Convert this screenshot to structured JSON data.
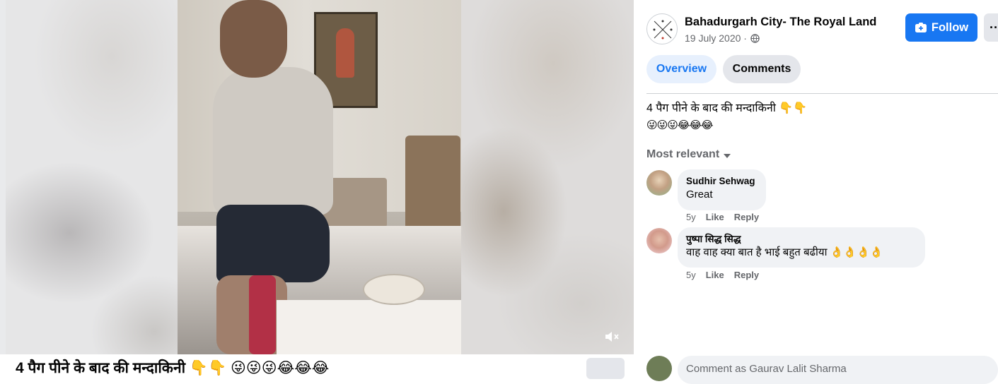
{
  "video": {
    "caption": "4 पैग पीने के बाद की मन्दाकिनी 👇👇 😜😜😜😂😂😂",
    "mute_icon": "speaker-muted-icon"
  },
  "post": {
    "page_name": "Bahadurgarh City- The Royal Land",
    "date": "19 July 2020",
    "date_separator": "·",
    "privacy_icon": "globe-icon",
    "follow_label": "Follow",
    "more_label": "···",
    "text": "4 पैग पीने के बाद की मन्दाकिनी 👇👇",
    "emojis": "😜😜😜😂😂😂"
  },
  "tabs": {
    "overview": "Overview",
    "comments": "Comments",
    "active": "overview"
  },
  "comments_section": {
    "sort_label": "Most relevant",
    "items": [
      {
        "author": "Sudhir Sehwag",
        "text": "Great",
        "time": "5y",
        "like": "Like",
        "reply": "Reply"
      },
      {
        "author": "पुष्पा सिद्ध सिद्ध",
        "text": "वाह वाह क्या बात है भाई बहुत बढीया 👌👌👌👌",
        "time": "5y",
        "like": "Like",
        "reply": "Reply"
      }
    ],
    "input_placeholder": "Comment as Gaurav Lalit Sharma"
  },
  "colors": {
    "accent": "#1877f2",
    "tab_active_bg": "#e7f0fd",
    "bubble_bg": "#f0f2f5",
    "secondary_text": "#65676b"
  }
}
